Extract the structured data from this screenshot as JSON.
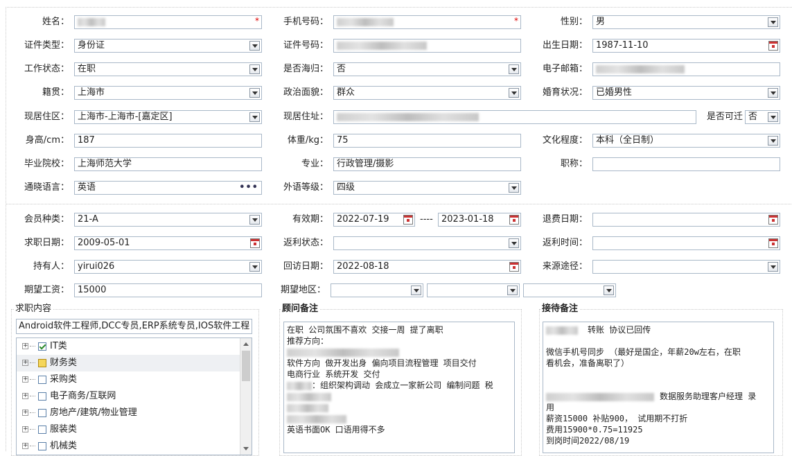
{
  "personal": {
    "name_label": "姓名：",
    "mobile_label": "手机号码：",
    "gender_label": "性别：",
    "gender_value": "男",
    "idtype_label": "证件类型：",
    "idtype_value": "身份证",
    "idno_label": "证件号码：",
    "birth_label": "出生日期：",
    "birth_value": "1987-11-10",
    "workstatus_label": "工作状态：",
    "workstatus_value": "在职",
    "returnee_label": "是否海归：",
    "returnee_value": "否",
    "email_label": "电子邮箱：",
    "origin_label": "籍贯：",
    "origin_value": "上海市",
    "political_label": "政治面貌：",
    "political_value": "群众",
    "marital_label": "婚育状况：",
    "marital_value": "已婚男性",
    "residence_label": "现居住区：",
    "residence_value": "上海市-上海市-[嘉定区]",
    "address_label": "现居住址：",
    "relocate_label": "是否可迁",
    "relocate_value": "否",
    "height_label": "身高/cm：",
    "height_value": "187",
    "weight_label": "体重/kg：",
    "weight_value": "75",
    "education_label": "文化程度：",
    "education_value": "本科（全日制）",
    "school_label": "毕业院校：",
    "school_value": "上海师范大学",
    "major_label": "专业：",
    "major_value": "行政管理/摄影",
    "title_label": "职称：",
    "language_label": "通晓语言：",
    "language_value": "英语",
    "language_more": "•••",
    "langlevel_label": "外语等级：",
    "langlevel_value": "四级"
  },
  "membership": {
    "type_label": "会员种类：",
    "type_value": "21-A",
    "valid_label": "有效期：",
    "valid_from": "2022-07-19",
    "valid_sep": "----",
    "valid_to": "2023-01-18",
    "refund_label": "退费日期：",
    "jobdate_label": "求职日期：",
    "jobdate_value": "2009-05-01",
    "rebate_label": "返利状态：",
    "rebatetime_label": "返利时间：",
    "holder_label": "持有人：",
    "holder_value": "yirui026",
    "visit_label": "回访日期：",
    "visit_value": "2022-08-18",
    "source_label": "来源途径：",
    "salary_label": "期望工资：",
    "salary_value": "15000",
    "region_label": "期望地区："
  },
  "jobcontent": {
    "title": "求职内容",
    "summary": "Android软件工程师,DCC专员,ERP系统专员,IOS软件工程",
    "items": [
      {
        "label": "IT类"
      },
      {
        "label": "财务类"
      },
      {
        "label": "采购类"
      },
      {
        "label": "电子商务/互联网"
      },
      {
        "label": "房地产/建筑/物业管理"
      },
      {
        "label": "服装类"
      },
      {
        "label": "机械类"
      }
    ]
  },
  "advisor": {
    "title": "顾问备注",
    "lines": [
      "在职  公司氛围不喜欢  交接一周 提了离职",
      "推荐方向：",
      "",
      "软件方向 做开发出身 偏向项目流程管理 项目交付",
      "电商行业 系统开发 交付",
      "：组织架构调动  会成立一家新公司  编制问题 税",
      "",
      "",
      "",
      "英语书面OK 口语用得不多"
    ]
  },
  "reception": {
    "title": "接待备注",
    "lines": [
      "转账  协议已回传",
      "",
      " 微信手机号同步  （最好是国企，年薪20w左右，在职",
      "看机会，准备离职了）",
      "",
      "",
      "数据服务助理客户经理  录",
      "用",
      "薪资15000 补贴900， 试用期不打折",
      "费用15900*0.75=11925",
      "到岗时间2022/08/19"
    ]
  }
}
